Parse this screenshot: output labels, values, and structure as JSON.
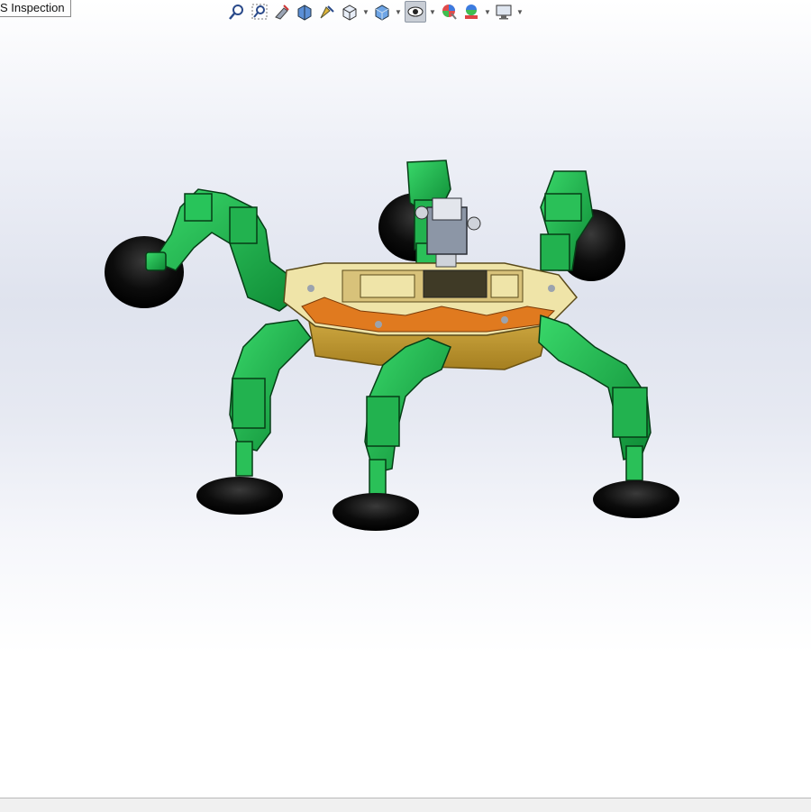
{
  "tab": {
    "label": "S Inspection"
  },
  "toolbar": {
    "icons": [
      "zoom-to-fit-icon",
      "zoom-to-area-icon",
      "previous-view-icon",
      "section-view-icon",
      "dynamic-annotation-icon",
      "view-orientation-icon",
      "display-style-icon",
      "hide-show-items-icon",
      "edit-appearance-icon",
      "apply-scene-icon",
      "view-settings-icon"
    ]
  },
  "colors": {
    "leg_green": "#1fb24a",
    "leg_dark": "#0b5a22",
    "body_cream": "#efe4a8",
    "body_orange": "#e07a1f",
    "body_gold": "#c9a23a",
    "foot_black": "#0a0a0a",
    "camera_gray": "#8c96a6"
  }
}
